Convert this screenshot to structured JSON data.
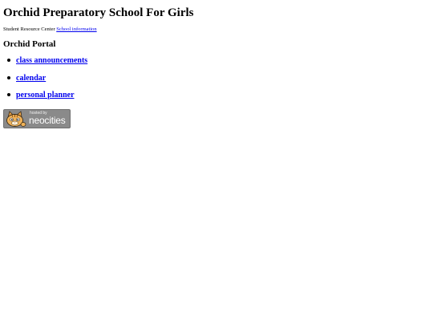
{
  "header": {
    "title": "Orchid Preparatory School For Girls",
    "subtitle_text": "Student Resource Center",
    "subtitle_link": "School information"
  },
  "portal": {
    "heading": "Orchid Portal",
    "links": [
      {
        "label": "class announcements"
      },
      {
        "label": "calendar"
      },
      {
        "label": "personal planner"
      }
    ]
  },
  "footer_badge": {
    "hosted_text": "hosted by",
    "brand_text": "neocities",
    "icon": "neocities-cat-icon",
    "colors": {
      "badge_bg": "#8a8a8a",
      "cat_orange": "#e8a24a"
    }
  },
  "colors": {
    "link": "#0000ee",
    "text": "#000000",
    "background": "#ffffff"
  }
}
